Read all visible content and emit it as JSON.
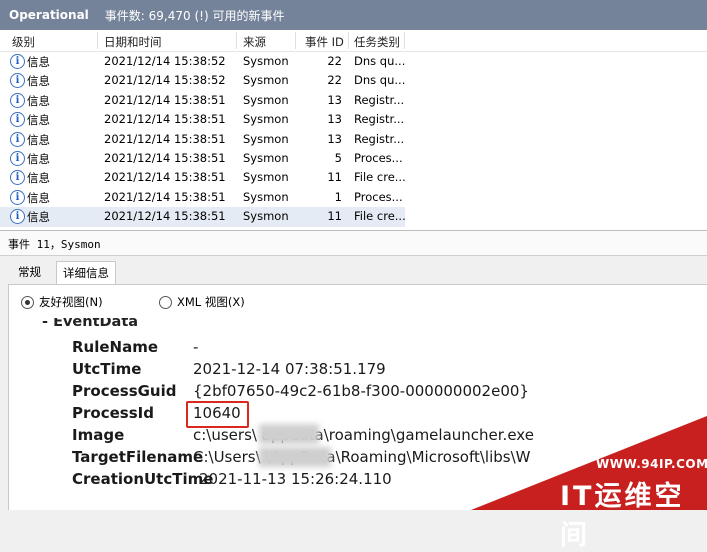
{
  "titlebar": {
    "name": "Operational",
    "count_text": "事件数: 69,470 (!) 可用的新事件"
  },
  "grid": {
    "headers": {
      "level": "级别",
      "date": "日期和时间",
      "source": "来源",
      "event_id": "事件 ID",
      "task": "任务类别"
    },
    "rows": [
      {
        "level": "信息",
        "date": "2021/12/14 15:38:52",
        "source": "Sysmon",
        "event_id": "22",
        "task": "Dns qu..."
      },
      {
        "level": "信息",
        "date": "2021/12/14 15:38:52",
        "source": "Sysmon",
        "event_id": "22",
        "task": "Dns qu..."
      },
      {
        "level": "信息",
        "date": "2021/12/14 15:38:51",
        "source": "Sysmon",
        "event_id": "13",
        "task": "Registr..."
      },
      {
        "level": "信息",
        "date": "2021/12/14 15:38:51",
        "source": "Sysmon",
        "event_id": "13",
        "task": "Registr..."
      },
      {
        "level": "信息",
        "date": "2021/12/14 15:38:51",
        "source": "Sysmon",
        "event_id": "13",
        "task": "Registr..."
      },
      {
        "level": "信息",
        "date": "2021/12/14 15:38:51",
        "source": "Sysmon",
        "event_id": "5",
        "task": "Proces..."
      },
      {
        "level": "信息",
        "date": "2021/12/14 15:38:51",
        "source": "Sysmon",
        "event_id": "11",
        "task": "File cre..."
      },
      {
        "level": "信息",
        "date": "2021/12/14 15:38:51",
        "source": "Sysmon",
        "event_id": "1",
        "task": "Proces..."
      },
      {
        "level": "信息",
        "date": "2021/12/14 15:38:51",
        "source": "Sysmon",
        "event_id": "11",
        "task": "File cre..."
      }
    ],
    "info_icon": "information-icon"
  },
  "event_header": "事件 11，Sysmon",
  "tabs": {
    "general": "常规",
    "details": "详细信息"
  },
  "view": {
    "friendly": "友好视图(N)",
    "xml": "XML 视图(X)"
  },
  "event_data": {
    "section": "- EventData",
    "fields": [
      {
        "name": "RuleName",
        "value": "-"
      },
      {
        "name": "UtcTime",
        "value": "2021-12-14 07:38:51.179"
      },
      {
        "name": "ProcessGuid",
        "value": "{2bf07650-49c2-61b8-f300-000000002e00}"
      },
      {
        "name": "ProcessId",
        "value": "10640"
      },
      {
        "name": "Image",
        "value": "c:\\users\\              appdata\\roaming\\gamelauncher.exe"
      },
      {
        "name": "TargetFilename",
        "value": "C:\\Users\\             \\AppData\\Roaming\\Microsoft\\libs\\W"
      },
      {
        "name": "CreationUtcTime",
        "value": "2021-11-13 15:26:24.110"
      }
    ]
  },
  "watermark": {
    "url": "WWW.94IP.COM",
    "name": "IT运维空间"
  }
}
